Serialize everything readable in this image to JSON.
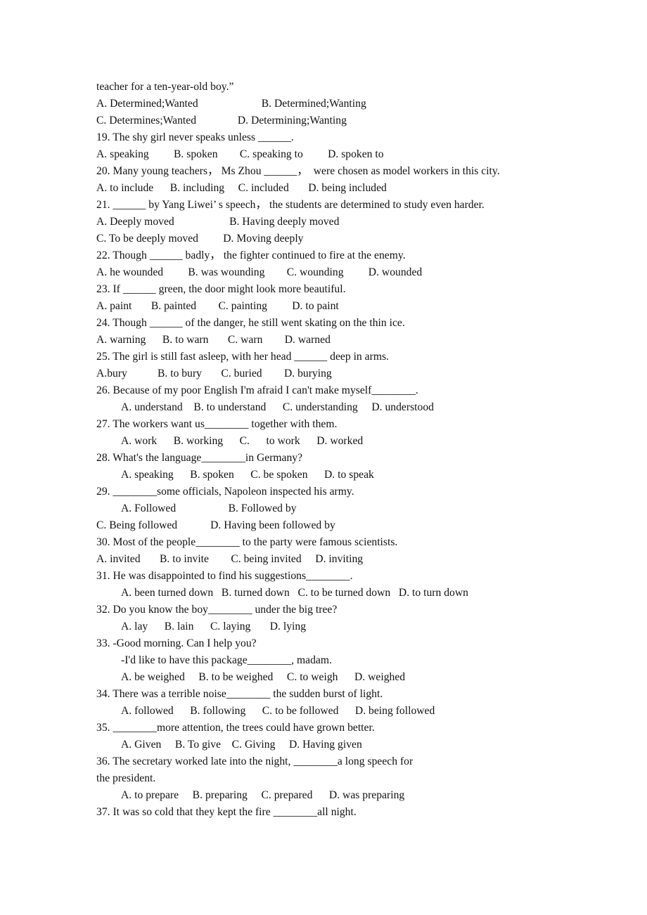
{
  "document": {
    "type": "grammar-exercise-worksheet",
    "page_background": "#ffffff",
    "text_color": "#111111"
  },
  "lines": [
    {
      "id": "l01",
      "indent": false,
      "text": "teacher for a ten-year-old boy.”"
    },
    {
      "id": "l02",
      "indent": false,
      "text": "A. Determined;Wanted                       B. Determined;Wanting"
    },
    {
      "id": "l03",
      "indent": false,
      "text": "C. Determines;Wanted               D. Determining;Wanting"
    },
    {
      "id": "l04",
      "indent": false,
      "text": "19. The shy girl never speaks unless ______."
    },
    {
      "id": "l05",
      "indent": false,
      "text": "A. speaking         B. spoken        C. speaking to         D. spoken to"
    },
    {
      "id": "l06",
      "indent": false,
      "text": "20. Many young teachers， Ms Zhou ______，  were chosen as model workers in this city."
    },
    {
      "id": "l07",
      "indent": false,
      "text": "A. to include      B. including     C. included       D. being included"
    },
    {
      "id": "l08",
      "indent": false,
      "text": "21. ______ by Yang Liwei’ s speech， the students are determined to study even harder."
    },
    {
      "id": "l09",
      "indent": false,
      "text": "A. Deeply moved                    B. Having deeply moved"
    },
    {
      "id": "l10",
      "indent": false,
      "text": "C. To be deeply moved         D. Moving deeply"
    },
    {
      "id": "l11",
      "indent": false,
      "text": "22. Though ______ badly， the fighter continued to fire at the enemy."
    },
    {
      "id": "l12",
      "indent": false,
      "text": "A. he wounded         B. was wounding        C. wounding         D. wounded"
    },
    {
      "id": "l13",
      "indent": false,
      "text": "23. If ______ green, the door might look more beautiful."
    },
    {
      "id": "l14",
      "indent": false,
      "text": "A. paint       B. painted        C. painting         D. to paint"
    },
    {
      "id": "l15",
      "indent": false,
      "text": "24. Though ______ of the danger, he still went skating on the thin ice."
    },
    {
      "id": "l16",
      "indent": false,
      "text": "A. warning      B. to warn       C. warn        D. warned"
    },
    {
      "id": "l17",
      "indent": false,
      "text": "25. The girl is still fast asleep, with her head ______ deep in arms."
    },
    {
      "id": "l18",
      "indent": false,
      "text": "A.bury           B. to bury       C. buried        D. burying"
    },
    {
      "id": "l19",
      "indent": false,
      "text": "26. Because of my poor English I'm afraid I can't make myself________."
    },
    {
      "id": "l20",
      "indent": true,
      "text": "A. understand    B. to understand      C. understanding     D. understood"
    },
    {
      "id": "l21",
      "indent": false,
      "text": "27. The workers want us________ together with them."
    },
    {
      "id": "l22",
      "indent": true,
      "text": "A. work      B. working      C.      to work      D. worked"
    },
    {
      "id": "l23",
      "indent": false,
      "text": "28. What's the language________in Germany?"
    },
    {
      "id": "l24",
      "indent": true,
      "text": "A. speaking      B. spoken      C. be spoken      D. to speak"
    },
    {
      "id": "l25",
      "indent": false,
      "text": "29. ________some officials, Napoleon inspected his army."
    },
    {
      "id": "l26",
      "indent": true,
      "text": "A. Followed                   B. Followed by"
    },
    {
      "id": "l27",
      "indent": false,
      "text": "C. Being followed            D. Having been followed by"
    },
    {
      "id": "l28",
      "indent": false,
      "text": "30. Most of the people________ to the party were famous scientists."
    },
    {
      "id": "l29",
      "indent": false,
      "text": "A. invited       B. to invite        C. being invited     D. inviting"
    },
    {
      "id": "l30",
      "indent": false,
      "text": "31. He was disappointed to find his suggestions________."
    },
    {
      "id": "l31",
      "indent": true,
      "text": "A. been turned down   B. turned down   C. to be turned down   D. to turn down"
    },
    {
      "id": "l32",
      "indent": false,
      "text": "32. Do you know the boy________ under the big tree?"
    },
    {
      "id": "l33",
      "indent": true,
      "text": "A. lay      B. lain      C. laying       D. lying"
    },
    {
      "id": "l34",
      "indent": false,
      "text": "33. -Good morning. Can I help you?"
    },
    {
      "id": "l35",
      "indent": true,
      "text": "-I'd like to have this package________, madam."
    },
    {
      "id": "l36",
      "indent": true,
      "text": "A. be weighed     B. to be weighed     C. to weigh      D. weighed"
    },
    {
      "id": "l37",
      "indent": false,
      "text": "34. There was a terrible noise________ the sudden burst of light."
    },
    {
      "id": "l38",
      "indent": true,
      "text": "A. followed      B. following      C. to be followed      D. being followed"
    },
    {
      "id": "l39",
      "indent": false,
      "text": "35. ________more attention, the trees could have grown better."
    },
    {
      "id": "l40",
      "indent": true,
      "text": "A. Given     B. To give    C. Giving     D. Having given"
    },
    {
      "id": "l41",
      "indent": false,
      "text": "36. The secretary worked late into the night, ________a long speech for"
    },
    {
      "id": "l42",
      "indent": false,
      "text": "the president."
    },
    {
      "id": "l43",
      "indent": true,
      "text": "A. to prepare     B. preparing     C. prepared      D. was preparing"
    },
    {
      "id": "l44",
      "indent": false,
      "text": "37. It was so cold that they kept the fire ________all night."
    }
  ]
}
